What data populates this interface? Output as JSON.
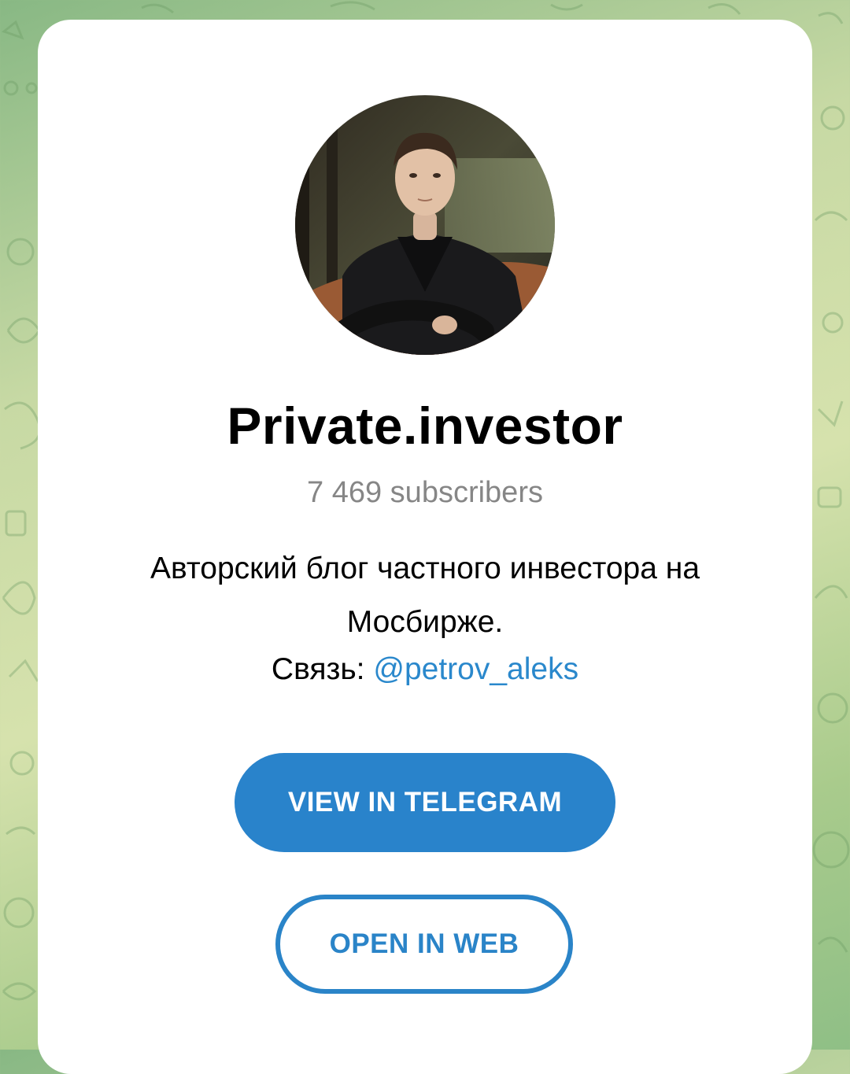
{
  "channel": {
    "title": "Private.investor",
    "subscribers": "7 469 subscribers",
    "description": "Авторский блог частного инвестора на Мосбирже.",
    "contact_label": "Связь:",
    "contact_link": "@petrov_aleks"
  },
  "actions": {
    "view_in_telegram": "VIEW IN TELEGRAM",
    "open_in_web": "OPEN IN WEB"
  },
  "colors": {
    "accent": "#2983cb",
    "link": "#2a88cc",
    "muted_text": "#868686",
    "background_green": "#a9cb8c"
  },
  "icons": {
    "avatar": "channel-avatar-photo"
  }
}
